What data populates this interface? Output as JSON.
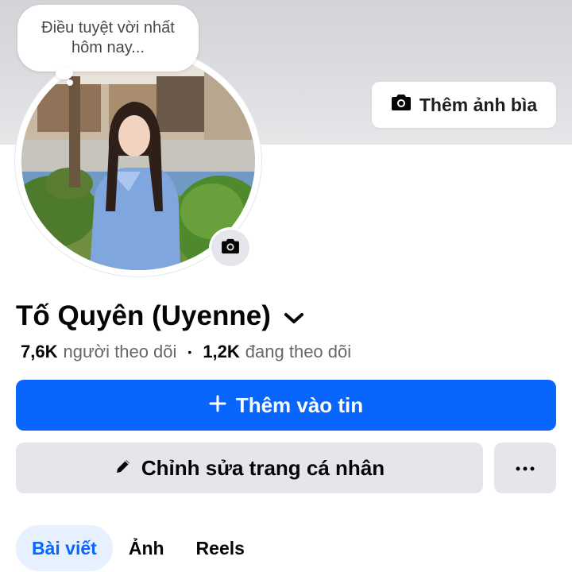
{
  "cover": {
    "add_cover_label": "Thêm ảnh bìa",
    "camera_icon": "camera-icon"
  },
  "note": {
    "line1": "Điều tuyệt vời nhất",
    "line2": "hôm nay..."
  },
  "profile": {
    "name": "Tố Quyên (Uyenne)",
    "dropdown_icon": "chevron-down-icon",
    "followers_count": "7,6K",
    "followers_label": "người theo dõi",
    "separator": "•",
    "following_count": "1,2K",
    "following_label": "đang theo dõi"
  },
  "actions": {
    "add_story_icon": "plus-icon",
    "add_story_label": "Thêm vào tin",
    "edit_icon": "pencil-icon",
    "edit_label": "Chỉnh sửa trang cá nhân",
    "more_icon": "more-dots-icon"
  },
  "tabs": [
    {
      "label": "Bài viết",
      "active": true
    },
    {
      "label": "Ảnh",
      "active": false
    },
    {
      "label": "Reels",
      "active": false
    }
  ],
  "colors": {
    "accent": "#0866ff",
    "secondary_button": "#e4e6eb",
    "active_tab_bg": "#e7f0fe"
  }
}
